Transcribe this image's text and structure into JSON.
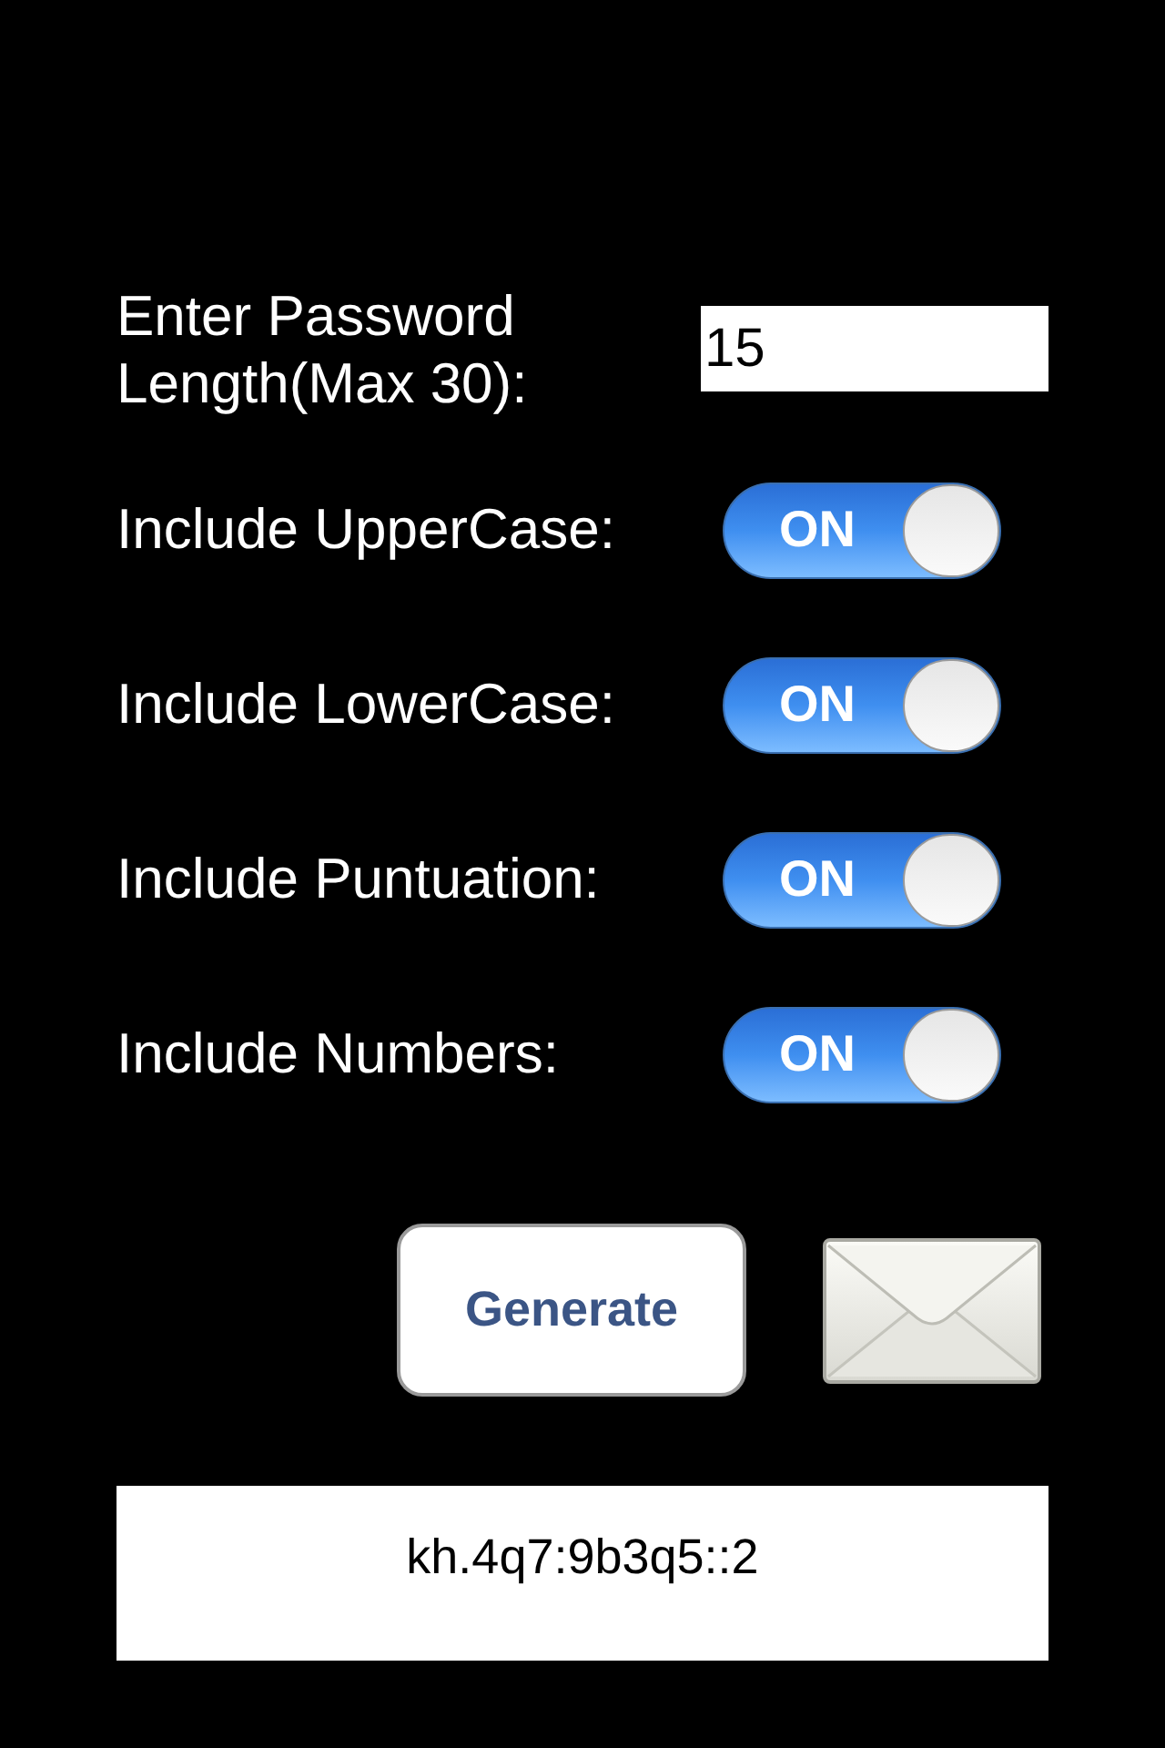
{
  "length_field": {
    "label": "Enter Password Length(Max 30):",
    "value": "15"
  },
  "options": [
    {
      "label": "Include UpperCase:",
      "on": true,
      "switch_text": "ON"
    },
    {
      "label": "Include LowerCase:",
      "on": true,
      "switch_text": "ON"
    },
    {
      "label": "Include Puntuation:",
      "on": true,
      "switch_text": "ON"
    },
    {
      "label": "Include Numbers:",
      "on": true,
      "switch_text": "ON"
    }
  ],
  "generate_button": "Generate",
  "result": "kh.4q7:9b3q5::2"
}
